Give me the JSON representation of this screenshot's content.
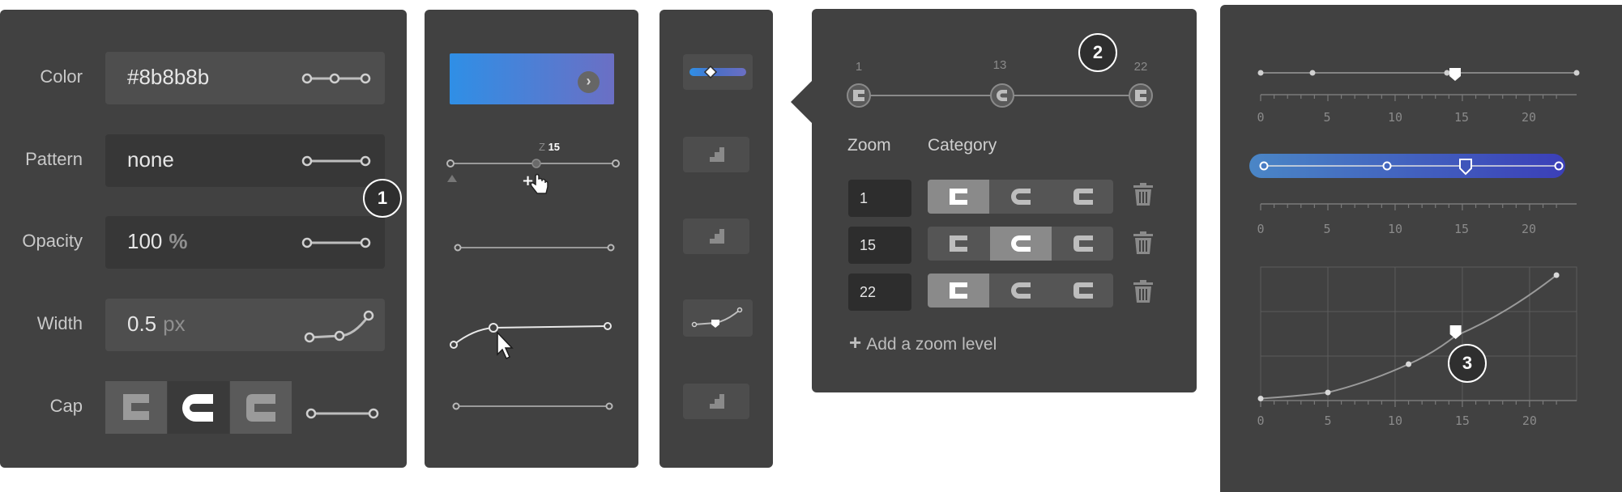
{
  "panel1": {
    "color": {
      "label": "Color",
      "value": "#8b8b8b"
    },
    "pattern": {
      "label": "Pattern",
      "value": "none"
    },
    "opacity": {
      "label": "Opacity",
      "value": "100",
      "unit": "%"
    },
    "width": {
      "label": "Width",
      "value": "0.5",
      "unit": "px"
    },
    "cap": {
      "label": "Cap",
      "options": [
        "butt",
        "round",
        "square"
      ],
      "selected": "round"
    }
  },
  "panel2": {
    "zoom_tooltip": {
      "prefix": "Z",
      "value": "15"
    }
  },
  "panel4": {
    "stop_labels": [
      "1",
      "13",
      "22"
    ],
    "zoom_header": "Zoom",
    "category_header": "Category",
    "rows": [
      {
        "zoom": "1",
        "selected": 0
      },
      {
        "zoom": "15",
        "selected": 1
      },
      {
        "zoom": "22",
        "selected": 0
      }
    ],
    "add_label": "Add a zoom level",
    "add_icon": "plus-icon"
  },
  "panel5": {
    "ticks": [
      "0",
      "5",
      "10",
      "15",
      "20"
    ]
  },
  "badges": [
    "1",
    "2",
    "3"
  ],
  "colors": {
    "panel": "#414141",
    "field": "#4e4e4e",
    "gradient_start": "#2f8fe6",
    "gradient_end": "#6b6fc4",
    "gradient2_start": "#4a86c6",
    "gradient2_end": "#3b3fb8"
  },
  "chart_data": {
    "type": "line",
    "x": [
      0,
      5,
      11,
      14.5,
      22
    ],
    "y": [
      0.05,
      0.2,
      0.9,
      1.6,
      3.1
    ],
    "xlabel": "",
    "ylabel": "",
    "x_ticks": [
      "0",
      "5",
      "10",
      "15",
      "20"
    ],
    "xlim": [
      0,
      22
    ],
    "grid": true
  }
}
